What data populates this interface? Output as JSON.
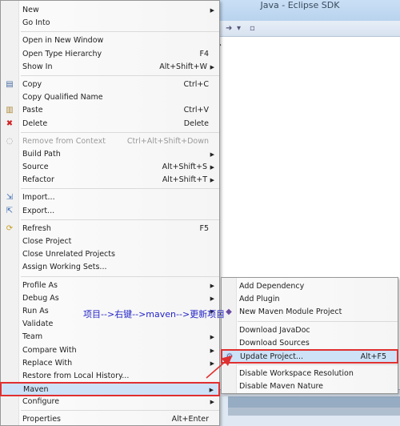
{
  "window": {
    "title": "Java - Eclipse SDK"
  },
  "toolbar": {
    "icons": [
      "arrow-right-icon",
      "dropdown-icon",
      "document-icon"
    ]
  },
  "context_menu": {
    "groups": [
      [
        {
          "label": "New",
          "submenu": true
        },
        {
          "label": "Go Into"
        }
      ],
      [
        {
          "label": "Open in New Window"
        },
        {
          "label": "Open Type Hierarchy",
          "shortcut": "F4"
        },
        {
          "label": "Show In",
          "shortcut": "Alt+Shift+W",
          "submenu": true
        }
      ],
      [
        {
          "label": "Copy",
          "shortcut": "Ctrl+C",
          "icon": "copy-icon"
        },
        {
          "label": "Copy Qualified Name"
        },
        {
          "label": "Paste",
          "shortcut": "Ctrl+V",
          "icon": "paste-icon"
        },
        {
          "label": "Delete",
          "shortcut": "Delete",
          "icon": "delete-icon"
        }
      ],
      [
        {
          "label": "Remove from Context",
          "shortcut": "Ctrl+Alt+Shift+Down",
          "disabled": true,
          "icon": "remove-context-icon"
        },
        {
          "label": "Build Path",
          "submenu": true
        },
        {
          "label": "Source",
          "shortcut": "Alt+Shift+S",
          "submenu": true
        },
        {
          "label": "Refactor",
          "shortcut": "Alt+Shift+T",
          "submenu": true
        }
      ],
      [
        {
          "label": "Import...",
          "icon": "import-icon"
        },
        {
          "label": "Export...",
          "icon": "export-icon"
        }
      ],
      [
        {
          "label": "Refresh",
          "shortcut": "F5",
          "icon": "refresh-icon"
        },
        {
          "label": "Close Project"
        },
        {
          "label": "Close Unrelated Projects"
        },
        {
          "label": "Assign Working Sets..."
        }
      ],
      [
        {
          "label": "Profile As",
          "submenu": true
        },
        {
          "label": "Debug As",
          "submenu": true
        },
        {
          "label": "Run As",
          "submenu": true
        },
        {
          "label": "Validate"
        },
        {
          "label": "Team",
          "submenu": true
        },
        {
          "label": "Compare With",
          "submenu": true
        },
        {
          "label": "Replace With",
          "submenu": true
        },
        {
          "label": "Restore from Local History..."
        },
        {
          "label": "Maven",
          "submenu": true,
          "selected": true
        },
        {
          "label": "Configure",
          "submenu": true
        }
      ],
      [
        {
          "label": "Properties",
          "shortcut": "Alt+Enter"
        }
      ]
    ]
  },
  "maven_submenu": {
    "groups": [
      [
        {
          "label": "Add Dependency"
        },
        {
          "label": "Add Plugin"
        },
        {
          "label": "New Maven Module Project",
          "icon": "maven-module-icon"
        }
      ],
      [
        {
          "label": "Download JavaDoc"
        },
        {
          "label": "Download Sources"
        },
        {
          "label": "Update Project...",
          "shortcut": "Alt+F5",
          "icon": "update-project-icon",
          "selected": true
        }
      ],
      [
        {
          "label": "Disable Workspace Resolution"
        },
        {
          "label": "Disable Maven Nature"
        }
      ]
    ]
  },
  "annotation": {
    "text": "项目-->右键-->maven-->更新项目"
  },
  "colors": {
    "annotation": "#2424c8",
    "highlight_box": "#e03030",
    "selection": "#cde2f7"
  }
}
